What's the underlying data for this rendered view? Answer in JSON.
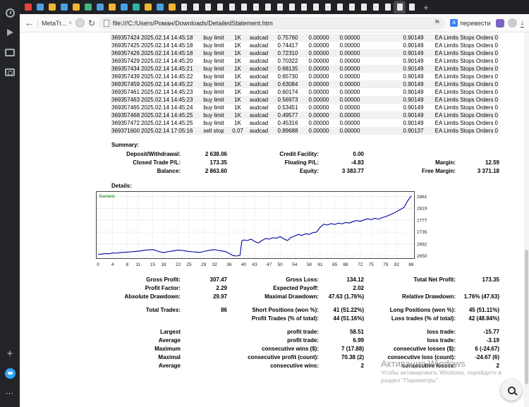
{
  "icons": {
    "back": "←",
    "close": "×",
    "refresh": "↻",
    "bookmark": "⚑",
    "download": "↓",
    "new_tab": "+",
    "sidebar_add": "+",
    "sidebar_more": "⋯",
    "translate_badge": "А"
  },
  "browser": {
    "tabs": [
      {
        "icon": "chart",
        "color": "#e8453c"
      },
      {
        "icon": "chart",
        "color": "#4a9fe3"
      },
      {
        "icon": "chart",
        "color": "#f2b431"
      },
      {
        "icon": "chart",
        "color": "#4a9fe3"
      },
      {
        "icon": "chart",
        "color": "#f2b431"
      },
      {
        "icon": "chart",
        "color": "#43b581"
      },
      {
        "icon": "chart",
        "color": "#4a9fe3"
      },
      {
        "icon": "chart",
        "color": "#f2b431"
      },
      {
        "icon": "chart",
        "color": "#4a9fe3"
      },
      {
        "icon": "chart",
        "color": "#2fb3a8"
      },
      {
        "icon": "chart",
        "color": "#f2b431"
      },
      {
        "icon": "chart",
        "color": "#4a9fe3"
      },
      {
        "icon": "chart",
        "color": "#f2b431"
      },
      {
        "icon": "doc"
      },
      {
        "icon": "doc"
      },
      {
        "icon": "doc"
      },
      {
        "icon": "doc"
      },
      {
        "icon": "doc"
      },
      {
        "icon": "doc"
      },
      {
        "icon": "doc"
      },
      {
        "icon": "doc"
      },
      {
        "icon": "doc"
      },
      {
        "icon": "doc"
      },
      {
        "icon": "doc"
      },
      {
        "icon": "doc"
      },
      {
        "icon": "doc"
      },
      {
        "icon": "doc"
      },
      {
        "icon": "doc"
      },
      {
        "icon": "doc"
      },
      {
        "icon": "doc"
      },
      {
        "icon": "doc"
      },
      {
        "icon": "doc",
        "active": true
      },
      {
        "icon": "doc"
      }
    ],
    "toolbar": {
      "tab_title": "MetaTr...",
      "url": "file:///C:/Users/Роман/Downloads/DetailedStatement.htm",
      "translate_label": "перевести"
    }
  },
  "statement": {
    "rows": [
      {
        "ticket": "369357424",
        "time": "2025.02.14 14:45:18",
        "type": "buy limit",
        "size": "1K",
        "symbol": "audcad",
        "price": "0.75760",
        "sl": "0.00000",
        "tp": "0.00000",
        "price2": "0.90149",
        "comment": "EA Limits Stops Orders 0"
      },
      {
        "ticket": "369357425",
        "time": "2025.02.14 14:45:18",
        "type": "buy limit",
        "size": "1K",
        "symbol": "audcad",
        "price": "0.74417",
        "sl": "0.00000",
        "tp": "0.00000",
        "price2": "0.90149",
        "comment": "EA Limits Stops Orders 0"
      },
      {
        "ticket": "369357426",
        "time": "2025.02.14 14:45:18",
        "type": "buy limit",
        "size": "1K",
        "symbol": "audcad",
        "price": "0.72310",
        "sl": "0.00000",
        "tp": "0.00000",
        "price2": "0.90149",
        "comment": "EA Limits Stops Orders 0"
      },
      {
        "ticket": "369357429",
        "time": "2025.02.14 14:45:20",
        "type": "buy limit",
        "size": "1K",
        "symbol": "audcad",
        "price": "0.70322",
        "sl": "0.00000",
        "tp": "0.00000",
        "price2": "0.90149",
        "comment": "EA Limits Stops Orders 0"
      },
      {
        "ticket": "369357434",
        "time": "2025.02.14 14:45:21",
        "type": "buy limit",
        "size": "1K",
        "symbol": "audcad",
        "price": "0.68135",
        "sl": "0.00000",
        "tp": "0.00000",
        "price2": "0.90149",
        "comment": "EA Limits Stops Orders 0"
      },
      {
        "ticket": "369357439",
        "time": "2025.02.14 14:45:22",
        "type": "buy limit",
        "size": "1K",
        "symbol": "audcad",
        "price": "0.65730",
        "sl": "0.00000",
        "tp": "0.00000",
        "price2": "0.90149",
        "comment": "EA Limits Stops Orders 0"
      },
      {
        "ticket": "369357459",
        "time": "2025.02.14 14:45:22",
        "type": "buy limit",
        "size": "1K",
        "symbol": "audcad",
        "price": "0.63084",
        "sl": "0.00000",
        "tp": "0.00000",
        "price2": "0.90149",
        "comment": "EA Limits Stops Orders 0"
      },
      {
        "ticket": "369357461",
        "time": "2025.02.14 14:45:23",
        "type": "buy limit",
        "size": "1K",
        "symbol": "audcad",
        "price": "0.60174",
        "sl": "0.00000",
        "tp": "0.00000",
        "price2": "0.90149",
        "comment": "EA Limits Stops Orders 0"
      },
      {
        "ticket": "369357463",
        "time": "2025.02.14 14:45:23",
        "type": "buy limit",
        "size": "1K",
        "symbol": "audcad",
        "price": "0.56973",
        "sl": "0.00000",
        "tp": "0.00000",
        "price2": "0.90149",
        "comment": "EA Limits Stops Orders 0"
      },
      {
        "ticket": "369357465",
        "time": "2025.02.14 14:45:24",
        "type": "buy limit",
        "size": "1K",
        "symbol": "audcad",
        "price": "0.53451",
        "sl": "0.00000",
        "tp": "0.00000",
        "price2": "0.90149",
        "comment": "EA Limits Stops Orders 0"
      },
      {
        "ticket": "369357468",
        "time": "2025.02.14 14:45:25",
        "type": "buy limit",
        "size": "1K",
        "symbol": "audcad",
        "price": "0.49577",
        "sl": "0.00000",
        "tp": "0.00000",
        "price2": "0.90149",
        "comment": "EA Limits Stops Orders 0"
      },
      {
        "ticket": "369357472",
        "time": "2025.02.14 14:45:25",
        "type": "buy limit",
        "size": "1K",
        "symbol": "audcad",
        "price": "0.45316",
        "sl": "0.00000",
        "tp": "0.00000",
        "price2": "0.90149",
        "comment": "EA Limits Stops Orders 0"
      },
      {
        "ticket": "369371600",
        "time": "2025.02.14 17:05:16",
        "type": "sell stop",
        "size": "0.07",
        "symbol": "audcad",
        "price": "0.89688",
        "sl": "0.00000",
        "tp": "0.00000",
        "price2": "0.90137",
        "comment": "EA Limits Stops Orders 0"
      }
    ],
    "summary_label": "Summary:",
    "summary": [
      [
        {
          "label": "Deposit/Withdrawal:",
          "value": "2 638.06"
        },
        {
          "label": "Credit Facility:",
          "value": "0.00"
        },
        {
          "label": "",
          "value": ""
        }
      ],
      [
        {
          "label": "Closed Trade P/L:",
          "value": "173.35"
        },
        {
          "label": "Floating P/L:",
          "value": "-4.83"
        },
        {
          "label": "Margin:",
          "value": "12.59"
        }
      ],
      [
        {
          "label": "Balance:",
          "value": "2 863.60"
        },
        {
          "label": "Equity:",
          "value": "3 383.77"
        },
        {
          "label": "Free Margin:",
          "value": "3 371.18"
        }
      ]
    ],
    "details_label": "Details:",
    "stats": [
      [
        {
          "label": "Gross Profit:",
          "value": "307.47"
        },
        {
          "label": "Gross Loss:",
          "value": "134.12"
        },
        {
          "label": "Total Net Profit:",
          "value": "173.35"
        }
      ],
      [
        {
          "label": "Profit Factor:",
          "value": "2.29"
        },
        {
          "label": "Expected Payoff:",
          "value": "2.02"
        },
        {
          "label": "",
          "value": ""
        }
      ],
      [
        {
          "label": "Absolute Drawdown:",
          "value": "29.97"
        },
        {
          "label": "Maximal Drawdown:",
          "value": "47.63 (1.76%)"
        },
        {
          "label": "Relative Drawdown:",
          "value": "1.76% (47.63)"
        }
      ],
      [
        {
          "label": "Total Trades:",
          "value": "86"
        },
        {
          "label": "Short Positions (won %):",
          "value": "41 (51.22%)"
        },
        {
          "label": "Long Positions (won %):",
          "value": "45 (51.11%)"
        }
      ],
      [
        {
          "label": "",
          "value": ""
        },
        {
          "label": "Profit Trades (% of total):",
          "value": "44 (51.16%)"
        },
        {
          "label": "Loss trades (% of total):",
          "value": "42 (48.84%)"
        }
      ],
      [
        {
          "label": "Largest",
          "value": ""
        },
        {
          "label": "profit trade:",
          "value": "58.51"
        },
        {
          "label": "loss trade:",
          "value": "-15.77"
        }
      ],
      [
        {
          "label": "Average",
          "value": ""
        },
        {
          "label": "profit trade:",
          "value": "6.99"
        },
        {
          "label": "loss trade:",
          "value": "-3.19"
        }
      ],
      [
        {
          "label": "Maximum",
          "value": ""
        },
        {
          "label": "consecutive wins ($):",
          "value": "7 (17.88)"
        },
        {
          "label": "consecutive losses ($):",
          "value": "6 (-24.67)"
        }
      ],
      [
        {
          "label": "Maximal",
          "value": ""
        },
        {
          "label": "consecutive profit (count):",
          "value": "70.38 (2)"
        },
        {
          "label": "consecutive loss (count):",
          "value": "-24.67 (6)"
        }
      ],
      [
        {
          "label": "Average",
          "value": ""
        },
        {
          "label": "consecutive wins:",
          "value": "2"
        },
        {
          "label": "consecutive losses:",
          "value": "2"
        }
      ]
    ]
  },
  "chart_data": {
    "type": "line",
    "title": "",
    "xlabel": "",
    "ylabel": "",
    "legend_position": "top-left-inside",
    "grid": "dotted",
    "xlim": [
      0,
      86
    ],
    "ylim": [
      2645,
      2875
    ],
    "x_ticks": [
      "0",
      "4",
      "8",
      "11",
      "15",
      "18",
      "22",
      "25",
      "29",
      "32",
      "36",
      "40",
      "43",
      "47",
      "50",
      "54",
      "58",
      "61",
      "65",
      "68",
      "72",
      "75",
      "79",
      "82",
      "86"
    ],
    "y_ticks": [
      "2861",
      "2819",
      "2777",
      "2735",
      "2692",
      "2650"
    ],
    "series": [
      {
        "name": "Баланс",
        "color": "#0000a0",
        "points": [
          [
            0,
            2656
          ],
          [
            1,
            2657
          ],
          [
            2,
            2659
          ],
          [
            3,
            2658
          ],
          [
            4,
            2661
          ],
          [
            5,
            2660
          ],
          [
            6,
            2662
          ],
          [
            7,
            2663
          ],
          [
            8,
            2664
          ],
          [
            9,
            2665
          ],
          [
            10,
            2666
          ],
          [
            11,
            2667
          ],
          [
            12,
            2669
          ],
          [
            13,
            2671
          ],
          [
            14,
            2672
          ],
          [
            15,
            2673
          ],
          [
            16,
            2669
          ],
          [
            17,
            2665
          ],
          [
            18,
            2662
          ],
          [
            19,
            2665
          ],
          [
            20,
            2667
          ],
          [
            21,
            2669
          ],
          [
            22,
            2671
          ],
          [
            23,
            2670
          ],
          [
            24,
            2668
          ],
          [
            25,
            2666
          ],
          [
            26,
            2665
          ],
          [
            27,
            2664
          ],
          [
            28,
            2663
          ],
          [
            29,
            2666
          ],
          [
            30,
            2669
          ],
          [
            31,
            2671
          ],
          [
            32,
            2673
          ],
          [
            33,
            2670
          ],
          [
            34,
            2668
          ],
          [
            35,
            2666
          ],
          [
            36,
            2659
          ],
          [
            37,
            2652
          ],
          [
            38,
            2650
          ],
          [
            39,
            2653
          ],
          [
            39.5,
            2704
          ],
          [
            40,
            2707
          ],
          [
            41,
            2705
          ],
          [
            42,
            2710
          ],
          [
            43,
            2702
          ],
          [
            44,
            2696
          ],
          [
            45,
            2705
          ],
          [
            46,
            2712
          ],
          [
            47,
            2710
          ],
          [
            48,
            2715
          ],
          [
            49,
            2713
          ],
          [
            50,
            2719
          ],
          [
            51,
            2711
          ],
          [
            52,
            2705
          ],
          [
            53,
            2716
          ],
          [
            54,
            2721
          ],
          [
            55,
            2727
          ],
          [
            56,
            2723
          ],
          [
            57,
            2729
          ],
          [
            58,
            2727
          ],
          [
            59,
            2733
          ],
          [
            60,
            2735
          ],
          [
            61,
            2752
          ],
          [
            62,
            2763
          ],
          [
            63,
            2760
          ],
          [
            64,
            2765
          ],
          [
            65,
            2762
          ],
          [
            66,
            2767
          ],
          [
            67,
            2764
          ],
          [
            68,
            2769
          ],
          [
            69,
            2767
          ],
          [
            70,
            2772
          ],
          [
            71,
            2776
          ],
          [
            72,
            2773
          ],
          [
            73,
            2778
          ],
          [
            74,
            2782
          ],
          [
            75,
            2779
          ],
          [
            76,
            2784
          ],
          [
            77,
            2781
          ],
          [
            78,
            2786
          ],
          [
            79,
            2790
          ],
          [
            80,
            2795
          ],
          [
            81,
            2801
          ],
          [
            82,
            2808
          ],
          [
            83,
            2815
          ],
          [
            84,
            2822
          ],
          [
            85,
            2845
          ],
          [
            86,
            2863.6
          ]
        ]
      }
    ]
  },
  "watermark": {
    "title": "Активация Windows",
    "line1": "Чтобы активировать Windows, перейдите в",
    "line2": "раздел \"Параметры\"."
  }
}
